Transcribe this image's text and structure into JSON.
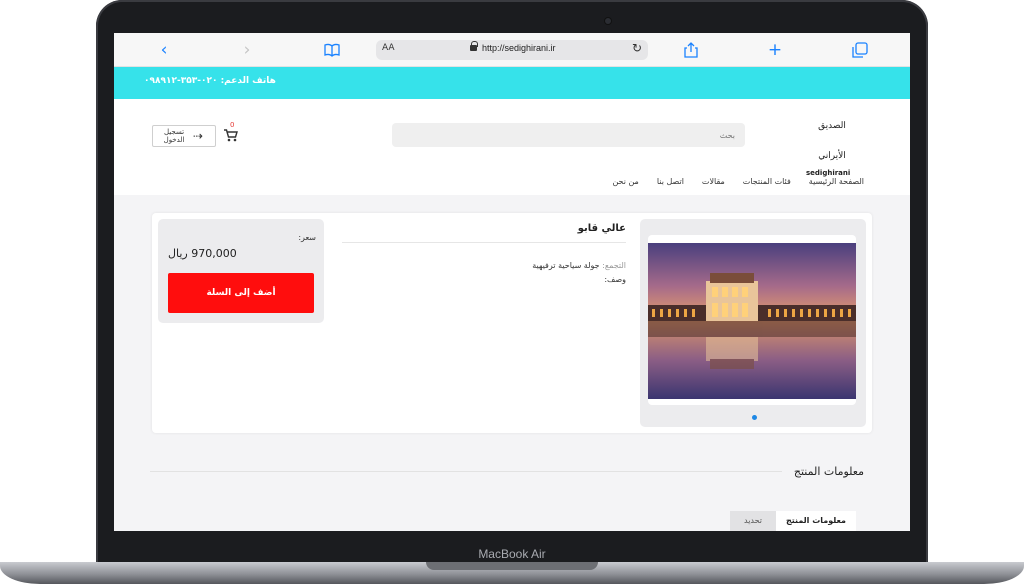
{
  "device": {
    "model_label": "MacBook Air"
  },
  "browser": {
    "url_aa": "AA",
    "url": "http://sedighirani.ir",
    "icons": {
      "back": "chevron-left-icon",
      "forward": "chevron-right-icon",
      "bookmarks": "book-icon",
      "share": "share-icon",
      "new_tab": "plus-icon",
      "tabs": "tabs-icon",
      "reload": "reload-icon",
      "lock": "lock-icon"
    }
  },
  "topbar": {
    "support_text": "هاتف الدعم: ۰۲۰-۳۵۳-۰۹۸۹۱۲",
    "color": "#36e2ea"
  },
  "header": {
    "login_label": "تسجيل الدخول",
    "cart_count": "0",
    "search_placeholder": "بحث",
    "logo_text": "الصديق الأيراني",
    "logo_sub": "sedighirani"
  },
  "nav": {
    "items": [
      {
        "label": "الصفحة الرئيسية"
      },
      {
        "label": "فئات المنتجات"
      },
      {
        "label": "مقالات"
      },
      {
        "label": "اتصل بنا"
      },
      {
        "label": "من نحن"
      }
    ]
  },
  "product": {
    "title": "عالي قابو",
    "group_label": "التجمع:",
    "group_value": "جولة سياحية ترفيهية",
    "description_label": "وصف:",
    "price_label": "سعر:",
    "price_value": "970,000 ريال",
    "add_to_cart": "أضف إلى السلة",
    "accent": "#ff0d0d"
  },
  "info": {
    "section_title": "معلومات المنتج",
    "tabs": [
      {
        "label": "معلومات المنتج"
      },
      {
        "label": "تحديد"
      }
    ]
  }
}
